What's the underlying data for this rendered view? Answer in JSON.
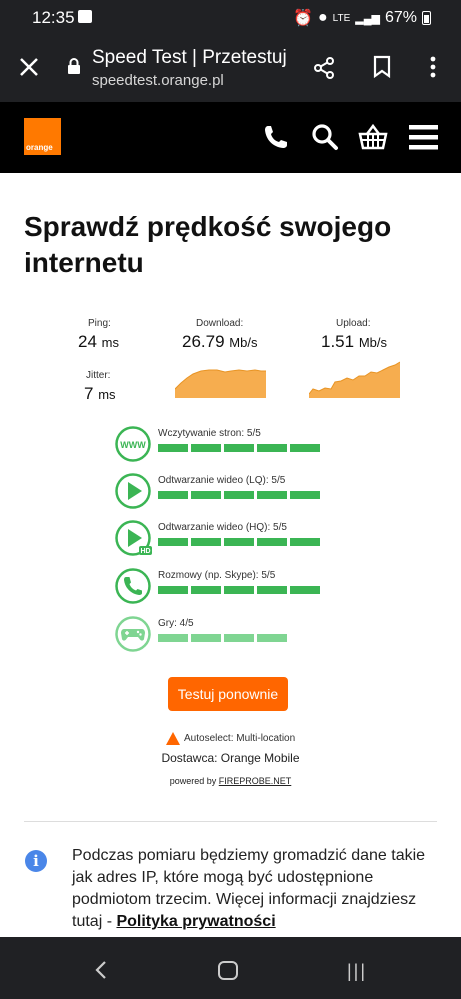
{
  "status_bar": {
    "time": "12:35",
    "network": "LTE",
    "battery": "67%"
  },
  "browser": {
    "title": "Speed Test | Przetestuj",
    "url": "speedtest.orange.pl"
  },
  "site": {
    "logo_text": "orange",
    "brand_color": "#ff7900"
  },
  "page": {
    "heading": "Sprawdź prędkość swojego internetu"
  },
  "results": {
    "ping_label": "Ping:",
    "ping_value": "24",
    "ping_unit": "ms",
    "jitter_label": "Jitter:",
    "jitter_value": "7",
    "jitter_unit": "ms",
    "download_label": "Download:",
    "download_value": "26.79",
    "download_unit": "Mb/s",
    "upload_label": "Upload:",
    "upload_value": "1.51",
    "upload_unit": "Mb/s"
  },
  "quality": [
    {
      "label": "Wczytywanie stron: 5/5",
      "score": 5,
      "icon": "www-icon"
    },
    {
      "label": "Odtwarzanie wideo (LQ): 5/5",
      "score": 5,
      "icon": "play-icon"
    },
    {
      "label": "Odtwarzanie wideo (HQ): 5/5",
      "score": 5,
      "icon": "play-hd-icon"
    },
    {
      "label": "Rozmowy (np. Skype): 5/5",
      "score": 5,
      "icon": "phone-icon"
    },
    {
      "label": "Gry: 4/5",
      "score": 4,
      "icon": "gamepad-icon"
    }
  ],
  "actions": {
    "retest_label": "Testuj ponownie"
  },
  "server": {
    "autoselect": "Autoselect: Multi-location",
    "provider": "Dostawca: Orange Mobile",
    "powered_prefix": "powered by",
    "powered_link": "FIREPROBE.NET"
  },
  "info": {
    "text": "Podczas pomiaru będziemy gromadzić dane takie jak adres IP, które mogą być udostępnione podmiotom trzecim. Więcej informacji znajdziesz tutaj - ",
    "link": "Polityka prywatności"
  },
  "colors": {
    "accent": "#ff6600",
    "bar_full": "#3bb554",
    "bar_light": "#7fd592",
    "chart_fill": "#f6ad4f"
  }
}
